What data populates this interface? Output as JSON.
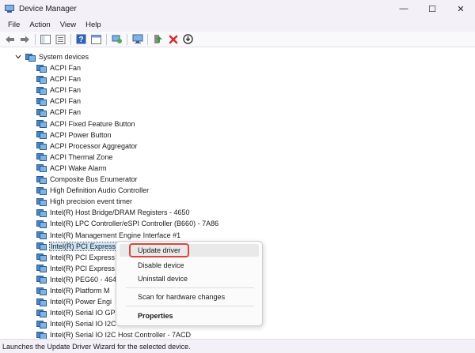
{
  "window": {
    "title": "Device Manager",
    "controls": {
      "minimize": "—",
      "maximize": "☐",
      "close": "✕"
    }
  },
  "menu": [
    "File",
    "Action",
    "View",
    "Help"
  ],
  "toolbar": [
    "back-arrow-icon",
    "forward-arrow-icon",
    "show-hide-tree-icon",
    "properties-icon",
    "help-icon",
    "details-view-icon",
    "scan-hardware-icon",
    "monitor-icon",
    "add-driver-icon",
    "uninstall-x-icon",
    "disable-device-icon"
  ],
  "tree": {
    "category": "System devices",
    "devices": [
      "ACPI Fan",
      "ACPI Fan",
      "ACPI Fan",
      "ACPI Fan",
      "ACPI Fan",
      "ACPI Fixed Feature Button",
      "ACPI Power Button",
      "ACPI Processor Aggregator",
      "ACPI Thermal Zone",
      "ACPI Wake Alarm",
      "Composite Bus Enumerator",
      "High Definition Audio Controller",
      "High precision event timer",
      "Intel(R) Host Bridge/DRAM Registers - 4650",
      "Intel(R) LPC Controller/eSPI Controller (B660) - 7A86",
      "Intel(R) Management Engine Interface #1",
      "Intel(R) PCI Express",
      "Intel(R) PCI Express",
      "Intel(R) PCI Express",
      "Intel(R) PEG60 - 464",
      "Intel(R) Platform M",
      "Intel(R) Power Engi",
      "Intel(R) Serial IO GP",
      "Intel(R) Serial IO I2C Host Controller - 7ACC",
      "Intel(R) Serial IO I2C Host Controller - 7ACD"
    ],
    "selected_index": 16
  },
  "context_menu": {
    "items": [
      "Update driver",
      "Disable device",
      "Uninstall device",
      "Scan for hardware changes",
      "Properties"
    ],
    "highlighted": "Update driver",
    "bold_item": "Properties",
    "ring_color": "#d9473b"
  },
  "status": "Launches the Update Driver Wizard for the selected device."
}
